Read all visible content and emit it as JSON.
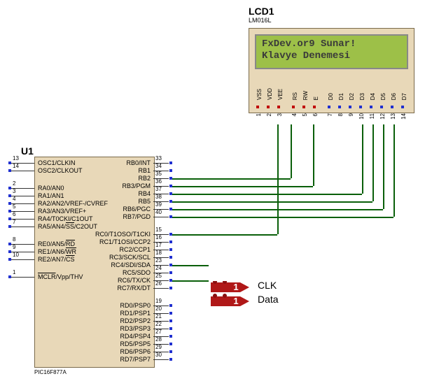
{
  "lcd": {
    "ref": "LCD1",
    "part": "LM016L",
    "line1": "FxDev.or9 Sunar!",
    "line2": "Klavye Denemesi",
    "pins": [
      "VSS",
      "VDD",
      "VEE",
      "RS",
      "RW",
      "E",
      "D0",
      "D1",
      "D2",
      "D3",
      "D4",
      "D5",
      "D6",
      "D7"
    ],
    "pinNums": [
      "1",
      "2",
      "3",
      "4",
      "5",
      "6",
      "7",
      "8",
      "9",
      "10",
      "11",
      "12",
      "13",
      "14"
    ]
  },
  "mcu": {
    "ref": "U1",
    "part": "PIC16F877A",
    "left": [
      {
        "num": "13",
        "name": "OSC1/CLKIN"
      },
      {
        "num": "14",
        "name": "OSC2/CLKOUT"
      },
      {
        "num": "2",
        "name": "RA0/AN0"
      },
      {
        "num": "3",
        "name": "RA1/AN1"
      },
      {
        "num": "4",
        "name": "RA2/AN2/VREF-/CVREF"
      },
      {
        "num": "5",
        "name": "RA3/AN3/VREF+"
      },
      {
        "num": "6",
        "name": "RA4/T0CKI/C1OUT"
      },
      {
        "num": "7",
        "name": "RA5/AN4/SS/C2OUT"
      },
      {
        "num": "8",
        "name": "RE0/AN5/RD"
      },
      {
        "num": "9",
        "name": "RE1/AN6/WR"
      },
      {
        "num": "10",
        "name": "RE2/AN7/CS"
      },
      {
        "num": "1",
        "name": "MCLR/Vpp/THV"
      }
    ],
    "right": [
      {
        "num": "33",
        "name": "RB0/INT"
      },
      {
        "num": "34",
        "name": "RB1"
      },
      {
        "num": "35",
        "name": "RB2"
      },
      {
        "num": "36",
        "name": "RB3/PGM"
      },
      {
        "num": "37",
        "name": "RB4"
      },
      {
        "num": "38",
        "name": "RB5"
      },
      {
        "num": "39",
        "name": "RB6/PGC"
      },
      {
        "num": "40",
        "name": "RB7/PGD"
      },
      {
        "num": "15",
        "name": "RC0/T1OSO/T1CKI"
      },
      {
        "num": "16",
        "name": "RC1/T1OSI/CCP2"
      },
      {
        "num": "17",
        "name": "RC2/CCP1"
      },
      {
        "num": "18",
        "name": "RC3/SCK/SCL"
      },
      {
        "num": "23",
        "name": "RC4/SDI/SDA"
      },
      {
        "num": "24",
        "name": "RC5/SDO"
      },
      {
        "num": "25",
        "name": "RC6/TX/CK"
      },
      {
        "num": "26",
        "name": "RC7/RX/DT"
      },
      {
        "num": "19",
        "name": "RD0/PSP0"
      },
      {
        "num": "20",
        "name": "RD1/PSP1"
      },
      {
        "num": "21",
        "name": "RD2/PSP2"
      },
      {
        "num": "22",
        "name": "RD3/PSP3"
      },
      {
        "num": "27",
        "name": "RD4/PSP4"
      },
      {
        "num": "28",
        "name": "RD5/PSP5"
      },
      {
        "num": "29",
        "name": "RD6/PSP6"
      },
      {
        "num": "30",
        "name": "RD7/PSP7"
      }
    ]
  },
  "probe": {
    "clk": "CLK",
    "clkVal": "1",
    "data": "Data",
    "dataVal": "1"
  }
}
